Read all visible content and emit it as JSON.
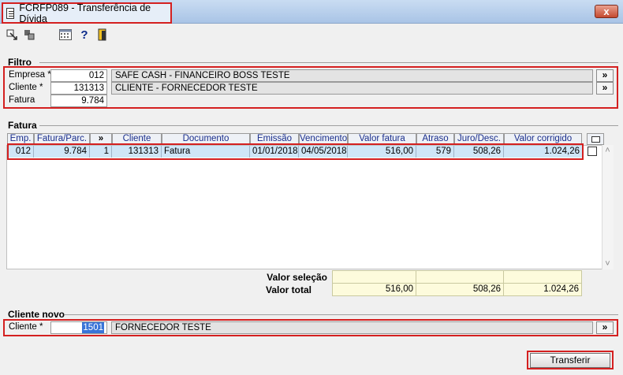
{
  "window": {
    "title": "FCRFP089 - Transferência de Dívida",
    "close_glyph": "x"
  },
  "toolbar": {
    "icons": [
      "export-icon",
      "copy-icon",
      "calculator-icon",
      "help-icon",
      "exit-door-icon"
    ],
    "help_glyph": "?"
  },
  "filtro": {
    "title": "Filtro",
    "empresa": {
      "label": "Empresa *",
      "value": "012",
      "description": "SAFE CASH - FINANCEIRO BOSS TESTE"
    },
    "cliente": {
      "label": "Cliente *",
      "value": "131313",
      "description": "CLIENTE - FORNECEDOR TESTE"
    },
    "fatura": {
      "label": "Fatura",
      "value": "9.784"
    },
    "lookup_label": "»"
  },
  "fatura": {
    "title": "Fatura",
    "columns": [
      "Emp.",
      "Fatura/Parc.",
      "»",
      "Cliente",
      "Documento",
      "Emissão",
      "Vencimento",
      "Valor fatura",
      "Atraso",
      "Juro/Desc.",
      "Valor corrigido"
    ],
    "rows": [
      {
        "emp": "012",
        "fatura": "9.784",
        "parc": "1",
        "cliente": "131313",
        "documento": "Fatura",
        "emissao": "01/01/2018",
        "vencimento": "04/05/2018",
        "valor_fatura": "516,00",
        "atraso": "579",
        "juro": "508,26",
        "valor_corrigido": "1.024,26",
        "selected": false
      }
    ],
    "scroll_up": "˄",
    "scroll_down": "˅"
  },
  "totals": {
    "selecao_label": "Valor seleção",
    "total_label": "Valor total",
    "total_valor_fatura": "516,00",
    "total_juro": "508,26",
    "total_corrigido": "1.024,26"
  },
  "cliente_novo": {
    "title": "Cliente novo",
    "label": "Cliente *",
    "value": "1501",
    "description": "FORNECEDOR TESTE",
    "lookup_label": "»"
  },
  "actions": {
    "transferir": "Transferir"
  }
}
